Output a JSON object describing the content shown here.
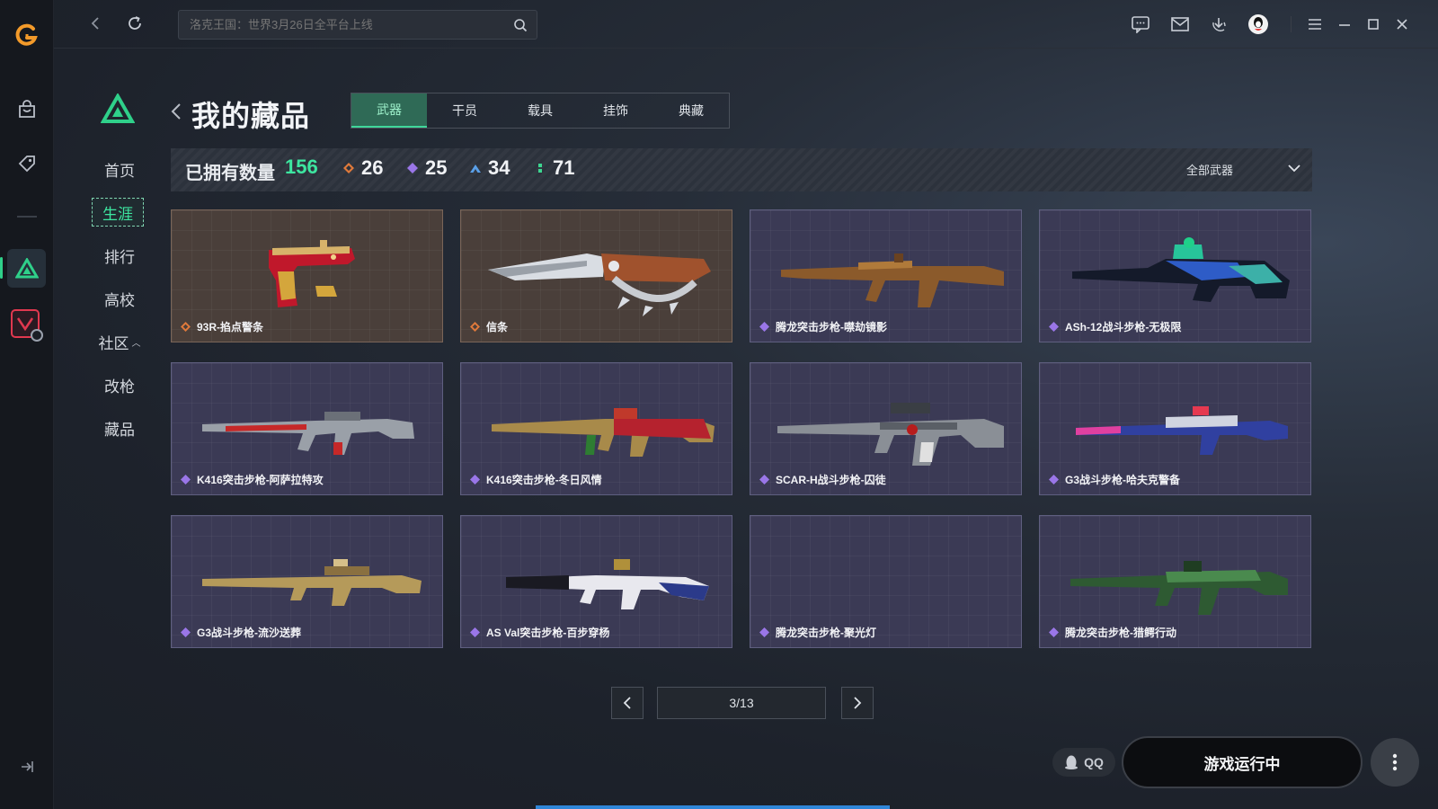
{
  "search": {
    "placeholder": "洛克王国：世界3月26日全平台上线"
  },
  "subnav": {
    "items": [
      {
        "label": "首页"
      },
      {
        "label": "生涯"
      },
      {
        "label": "排行"
      },
      {
        "label": "高校"
      },
      {
        "label": "社区"
      },
      {
        "label": "改枪"
      },
      {
        "label": "藏品"
      }
    ],
    "active_index": 1
  },
  "header": {
    "title": "我的藏品"
  },
  "tabs": [
    {
      "label": "武器"
    },
    {
      "label": "干员"
    },
    {
      "label": "载具"
    },
    {
      "label": "挂饰"
    },
    {
      "label": "典藏"
    }
  ],
  "stats": {
    "label": "已拥有数量",
    "total": "156",
    "counts": [
      {
        "value": "26",
        "color": "#e07a3b"
      },
      {
        "value": "25",
        "color": "#9a76e8"
      },
      {
        "value": "34",
        "color": "#5aa0e8"
      },
      {
        "value": "71",
        "color": "#3dd690"
      }
    ],
    "filter": "全部武器"
  },
  "items": [
    {
      "name": "93R-掐点警条",
      "rarity": "gold"
    },
    {
      "name": "信条",
      "rarity": "gold"
    },
    {
      "name": "腾龙突击步枪-噤劫镜影",
      "rarity": "purple"
    },
    {
      "name": "ASh-12战斗步枪-无极限",
      "rarity": "purple"
    },
    {
      "name": "K416突击步枪-阿萨拉特攻",
      "rarity": "purple"
    },
    {
      "name": "K416突击步枪-冬日风情",
      "rarity": "purple"
    },
    {
      "name": "SCAR-H战斗步枪-囚徒",
      "rarity": "purple"
    },
    {
      "name": "G3战斗步枪-哈夫克警备",
      "rarity": "purple"
    },
    {
      "name": "G3战斗步枪-流沙送葬",
      "rarity": "purple"
    },
    {
      "name": "AS Val突击步枪-百步穿杨",
      "rarity": "purple"
    },
    {
      "name": "腾龙突击步枪-聚光灯",
      "rarity": "purple"
    },
    {
      "name": "腾龙突击步枪-猎鳄行动",
      "rarity": "purple"
    }
  ],
  "pagination": {
    "label": "3/13"
  },
  "bottom": {
    "qq_label": "QQ",
    "run_label": "游戏运行中"
  },
  "colors": {
    "accent": "#3de6a0",
    "gold_rarity": "#e07a3b",
    "purple_rarity": "#9a76e8"
  }
}
